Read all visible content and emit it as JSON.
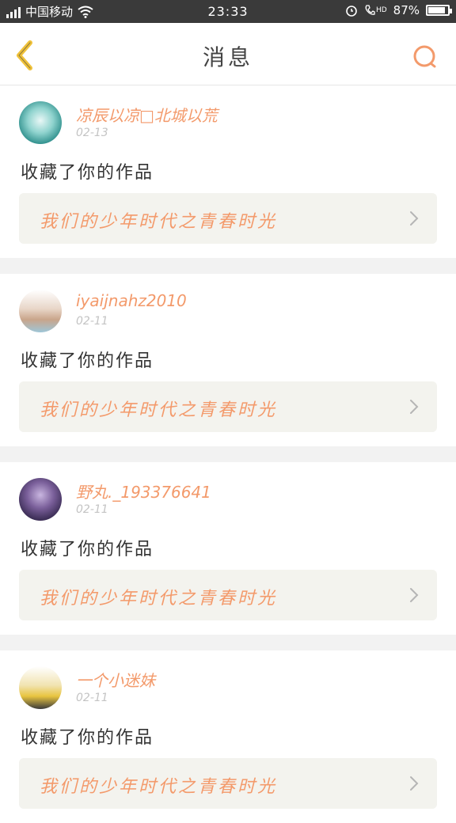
{
  "status_bar": {
    "carrier": "中国移动",
    "time": "23:33",
    "hd_label": "HD",
    "battery": "87%",
    "battery_level": 0.87
  },
  "header": {
    "title": "消息",
    "icons": {
      "back": "chevron-left-icon",
      "search": "search-icon"
    }
  },
  "messages": [
    {
      "username": "凉辰以凉□北城以荒",
      "date": "02-13",
      "action": "收藏了你的作品",
      "work_title": "我们的少年时代之青春时光"
    },
    {
      "username": "iyaijnahz2010",
      "date": "02-11",
      "action": "收藏了你的作品",
      "work_title": "我们的少年时代之青春时光"
    },
    {
      "username": "野丸._193376641",
      "date": "02-11",
      "action": "收藏了你的作品",
      "work_title": "我们的少年时代之青春时光"
    },
    {
      "username": "一个小迷妹",
      "date": "02-11",
      "action": "收藏了你的作品",
      "work_title": "我们的少年时代之青春时光"
    }
  ],
  "colors": {
    "accent": "#f39a6b",
    "back_icon": "#f0c23a",
    "status_bar_bg": "#3a3a3a",
    "card_bg": "#f3f3ee"
  }
}
